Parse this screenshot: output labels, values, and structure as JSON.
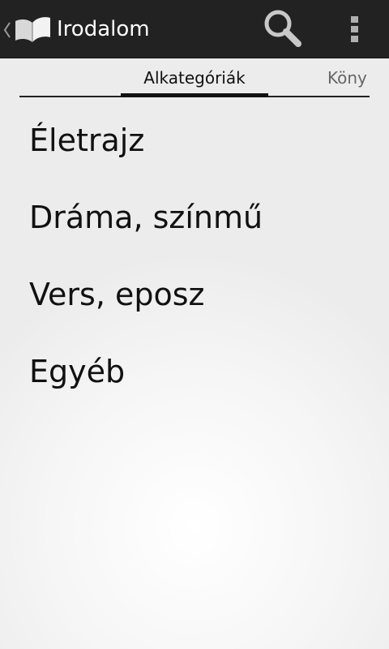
{
  "action_bar": {
    "title": "Irodalom",
    "up_icon": "chevron-left-icon",
    "app_icon": "open-book-icon",
    "search_icon": "search-icon",
    "overflow_icon": "overflow-menu-icon",
    "background_color": "#222222"
  },
  "tabs": [
    {
      "label": "Alkategóriák",
      "selected": true
    },
    {
      "label": "Köny",
      "selected": false
    }
  ],
  "list": {
    "items": [
      {
        "label": "Életrajz"
      },
      {
        "label": "Dráma, színmű"
      },
      {
        "label": "Vers, eposz"
      },
      {
        "label": "Egyéb"
      }
    ]
  }
}
